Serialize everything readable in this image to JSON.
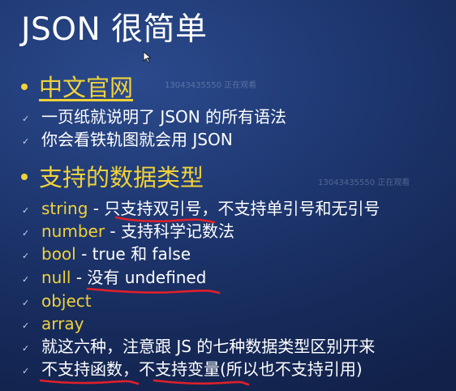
{
  "title": "JSON 很简单",
  "section1": {
    "heading": "中文官网",
    "items": [
      "一页纸就说明了 JSON 的所有语法",
      "你会看铁轨图就会用 JSON"
    ]
  },
  "section2": {
    "heading": "支持的数据类型",
    "items": [
      {
        "kw": "string",
        "rest": " - 只支持双引号，不支持单引号和无引号"
      },
      {
        "kw": "number",
        "rest": " - 支持科学记数法"
      },
      {
        "kw": "bool",
        "rest": " - true 和 false"
      },
      {
        "kw": "null",
        "rest": " - 没有 undefined"
      },
      {
        "kw": "object",
        "rest": ""
      },
      {
        "kw": "array",
        "rest": ""
      },
      {
        "kw": "",
        "rest": "就这六种，注意跟 JS 的七种数据类型区别开来"
      },
      {
        "kw": "",
        "rest": "不支持函数，不支持变量(所以也不支持引用)"
      }
    ]
  },
  "watermark": {
    "text1": "13043435550 正在观看",
    "text2": "13043435550 正在观看"
  },
  "colors": {
    "accent": "#f0d23a",
    "annotation": "#e0202a",
    "background": "#1c3468"
  },
  "icons": {
    "bullet": "dot",
    "list_marker": "check-mark",
    "cursor": "mouse-pointer"
  }
}
